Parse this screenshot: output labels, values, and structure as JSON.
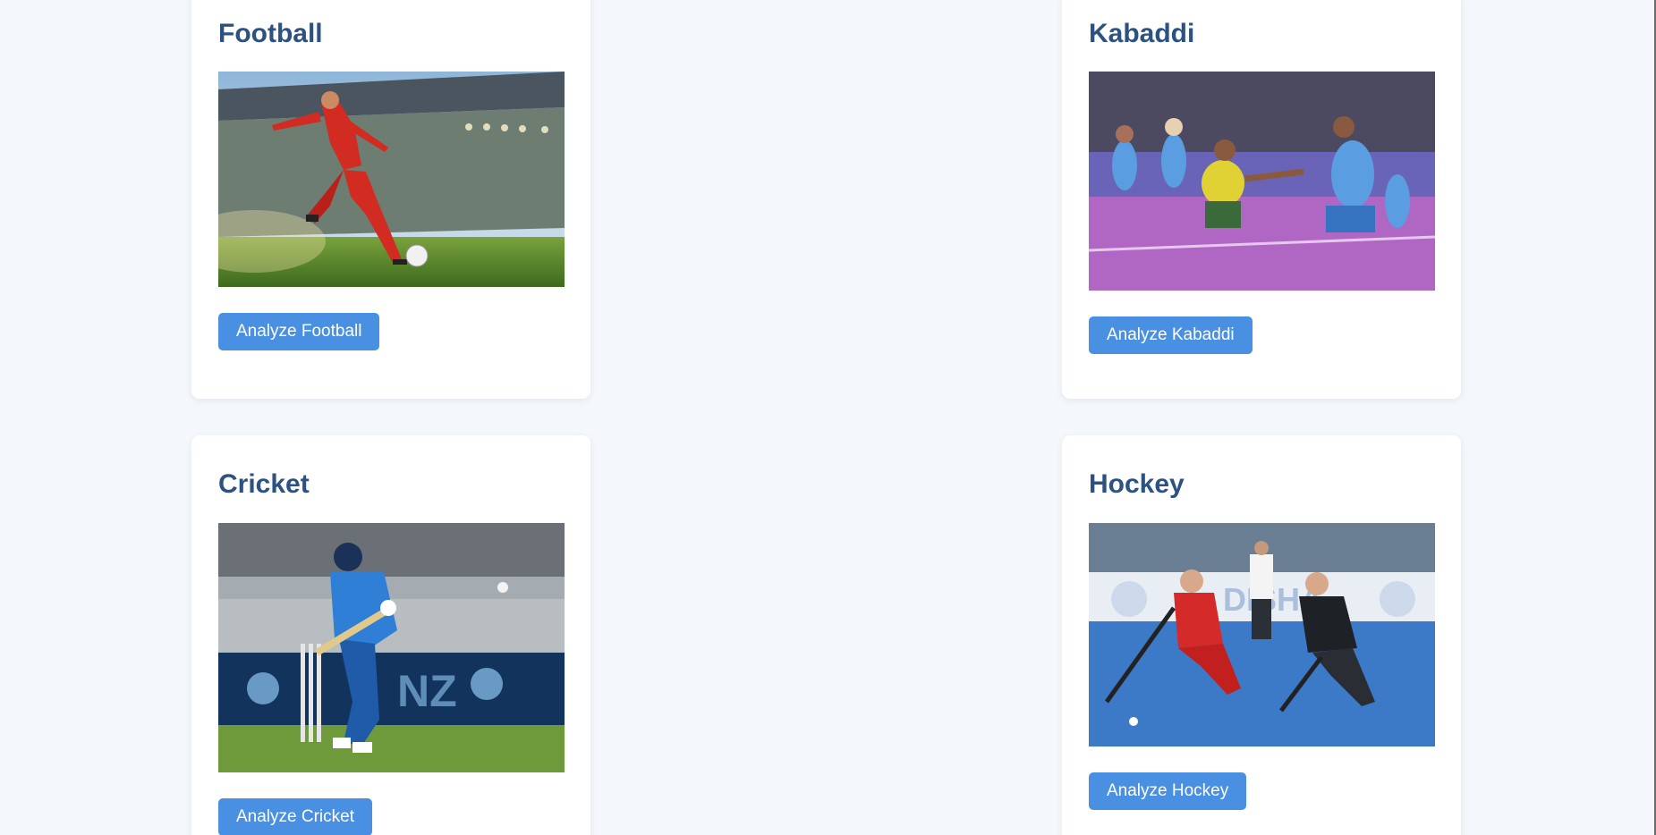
{
  "cards": [
    {
      "title": "Football",
      "button": "Analyze Football",
      "image_alt": "football-player-kicking-ball"
    },
    {
      "title": "Kabaddi",
      "button": "Analyze Kabaddi",
      "image_alt": "kabaddi-players-match"
    },
    {
      "title": "Cricket",
      "button": "Analyze Cricket",
      "image_alt": "cricket-batsman"
    },
    {
      "title": "Hockey",
      "button": "Analyze Hockey",
      "image_alt": "hockey-players-match"
    }
  ],
  "colors": {
    "page_bg": "#f4f7fb",
    "card_bg": "#ffffff",
    "title": "#2c5282",
    "button_bg": "#4a90e2",
    "button_text": "#ffffff"
  }
}
